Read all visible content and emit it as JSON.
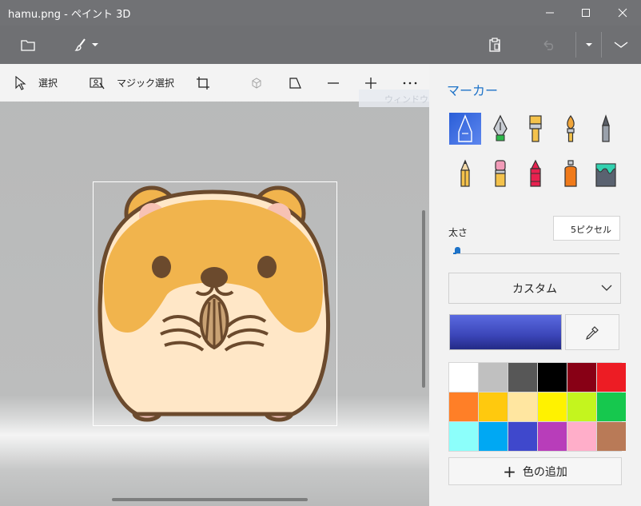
{
  "window": {
    "title": "hamu.png - ペイント 3D"
  },
  "subtoolbar": {
    "select_label": "選択",
    "magic_select_label": "マジック選択",
    "tooltip": "ウィンドウの領域切り取り(W)"
  },
  "panel": {
    "title": "マーカー",
    "brushes": [
      {
        "name": "marker",
        "icon": "marker-icon",
        "selected": true
      },
      {
        "name": "calligraphy-pen",
        "icon": "calligraphy-pen-icon"
      },
      {
        "name": "oil-brush",
        "icon": "oil-brush-icon"
      },
      {
        "name": "watercolor",
        "icon": "watercolor-icon"
      },
      {
        "name": "pixel-pen",
        "icon": "pixel-pen-icon"
      },
      {
        "name": "pencil",
        "icon": "pencil-icon"
      },
      {
        "name": "eraser",
        "icon": "eraser-icon"
      },
      {
        "name": "crayon",
        "icon": "crayon-icon"
      },
      {
        "name": "spray-can",
        "icon": "spray-can-icon"
      },
      {
        "name": "fill",
        "icon": "fill-bucket-icon"
      }
    ],
    "thickness_label": "太さ",
    "thickness_value": "5ピクセル",
    "thickness_fraction": 0.02,
    "finish_dropdown": "カスタム",
    "current_color": "#3b45b8",
    "swatches": [
      "#ffffff",
      "#c0c0c0",
      "#575757",
      "#000000",
      "#880015",
      "#ed1c24",
      "#ff7f27",
      "#ffc90e",
      "#ffe6a0",
      "#fff200",
      "#c4f51e",
      "#16c84e",
      "#8cfffb",
      "#00a8f3",
      "#3f48cc",
      "#b83dba",
      "#ffaec9",
      "#b97a57"
    ],
    "add_color_label": "色の追加"
  },
  "accent_color": "#1e73c8"
}
